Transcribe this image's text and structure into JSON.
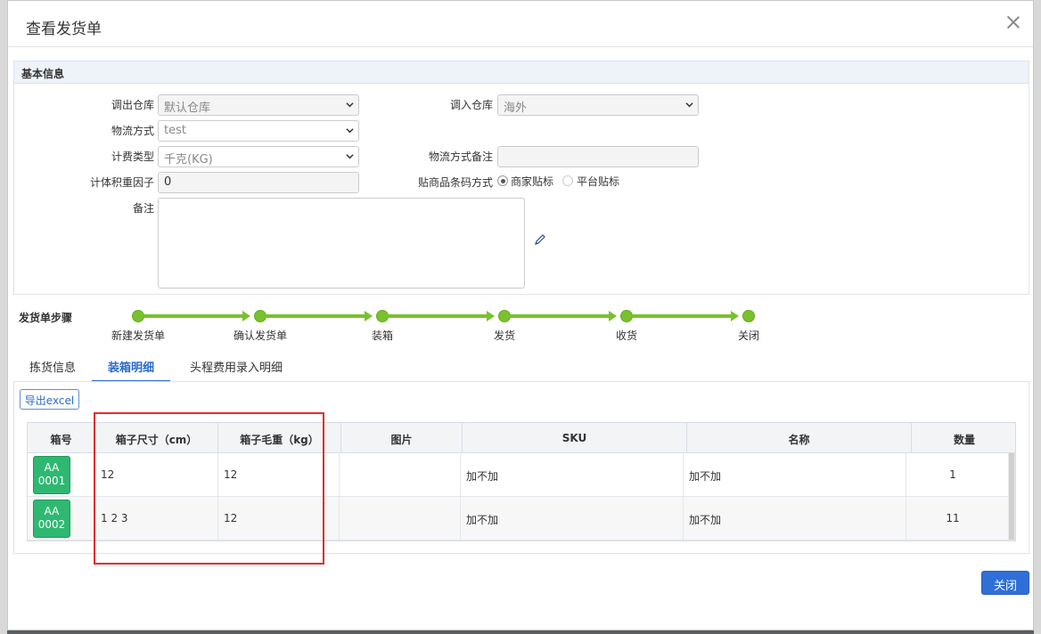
{
  "dialog": {
    "title": "查看发货单"
  },
  "basic_info": {
    "heading": "基本信息",
    "out_warehouse": {
      "label": "调出仓库",
      "value": "默认仓库"
    },
    "in_warehouse": {
      "label": "调入仓库",
      "value": "海外"
    },
    "logistics": {
      "label": "物流方式",
      "value": "test"
    },
    "billing_type": {
      "label": "计费类型",
      "value": "千克(KG)"
    },
    "logistics_note": {
      "label": "物流方式备注",
      "value": ""
    },
    "volume_factor": {
      "label": "计体积重因子",
      "value": "0"
    },
    "barcode_method": {
      "label": "贴商品条码方式",
      "options": [
        "商家贴标",
        "平台贴标"
      ],
      "selected": "商家贴标"
    },
    "remarks": {
      "label": "备注",
      "value": ""
    }
  },
  "steps": {
    "label": "发货单步骤",
    "items": [
      "新建发货单",
      "确认发货单",
      "装箱",
      "发货",
      "收货",
      "关闭"
    ],
    "color": "#79c12d"
  },
  "tabs": [
    {
      "label": "拣货信息",
      "active": false
    },
    {
      "label": "装箱明细",
      "active": true
    },
    {
      "label": "头程费用录入明细",
      "active": false
    }
  ],
  "toolbar": {
    "export_label": "导出excel"
  },
  "table": {
    "columns": [
      "箱号",
      "箱子尺寸（cm）",
      "箱子毛重（kg）",
      "图片",
      "SKU",
      "名称",
      "数量"
    ],
    "rows": [
      {
        "box_line1": "AA",
        "box_line2": "0001",
        "size": "12",
        "weight": "12",
        "image": "",
        "sku": "加不加",
        "name": "加不加",
        "qty": "1"
      },
      {
        "box_line1": "AA",
        "box_line2": "0002",
        "size": "1 2 3",
        "weight": "12",
        "image": "",
        "sku": "加不加",
        "name": "加不加",
        "qty": "11"
      }
    ]
  },
  "footer": {
    "close_label": "关闭"
  },
  "colors": {
    "accent": "#2f6fd8",
    "badge": "#2eb872",
    "highlight": "#e02d2d"
  }
}
